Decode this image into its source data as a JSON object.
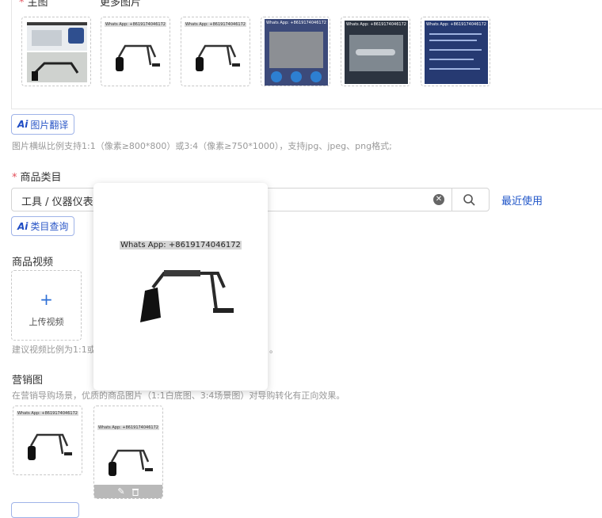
{
  "main_image_label": "主图",
  "more_images_label": "更多图片",
  "watermark_text": "Whats App: +8619174046172",
  "ai_image_translate_label": "图片翻译",
  "image_hint": "图片横纵比例支持1:1（像素≥800*800）或3:4（像素≥750*1000），支持jpg、jpeg、png格式;",
  "category": {
    "label": "商品类目",
    "value": "工具 / 仪器仪表 /",
    "recent_label": "最近使用",
    "ai_query_label": "类目查询"
  },
  "video": {
    "label": "商品视频",
    "upload_label": "上传视频",
    "hint_start": "建议视频比例为1:1或",
    "hint_end": "。"
  },
  "marketing": {
    "label": "营销图",
    "hint": "在营销导购场景，优质的商品图片（1:1白底图、3:4场景图）对导购转化有正向效果。"
  },
  "ai_badge": "Ai",
  "colors": {
    "accent": "#1f55c8",
    "required": "#e34d59"
  }
}
